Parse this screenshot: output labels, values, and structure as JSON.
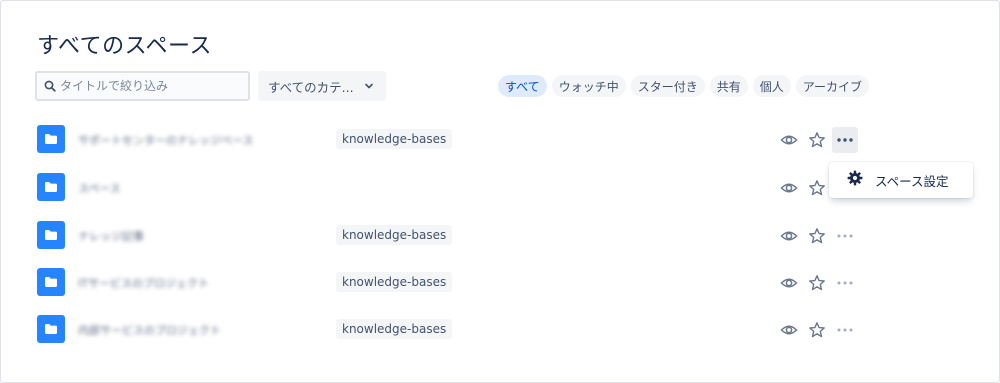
{
  "page": {
    "title": "すべてのスペース"
  },
  "search": {
    "placeholder": "タイトルで絞り込み",
    "value": ""
  },
  "category": {
    "label": "すべてのカテ..."
  },
  "filters": [
    {
      "label": "すべて",
      "active": true
    },
    {
      "label": "ウォッチ中",
      "active": false
    },
    {
      "label": "スター付き",
      "active": false
    },
    {
      "label": "共有",
      "active": false
    },
    {
      "label": "個人",
      "active": false
    },
    {
      "label": "アーカイブ",
      "active": false
    }
  ],
  "spaces": [
    {
      "name": "サポートセンターのナレッジベース",
      "tag": "knowledge-bases",
      "menu_open": true
    },
    {
      "name": "スペース",
      "tag": "",
      "menu_open": false
    },
    {
      "name": "ナレッジ記事",
      "tag": "knowledge-bases",
      "menu_open": false
    },
    {
      "name": "ITサービスのプロジェクト",
      "tag": "knowledge-bases",
      "menu_open": false
    },
    {
      "name": "内部サービスのプロジェクト",
      "tag": "knowledge-bases",
      "menu_open": false
    }
  ],
  "dropdown": {
    "item_label": "スペース設定",
    "icon": "gear-icon"
  },
  "colors": {
    "accent": "#0052cc",
    "folder": "#2684ff",
    "pill_active_bg": "#deebff",
    "pill_bg": "#f4f5f7",
    "icon_gray": "#6b778c"
  }
}
